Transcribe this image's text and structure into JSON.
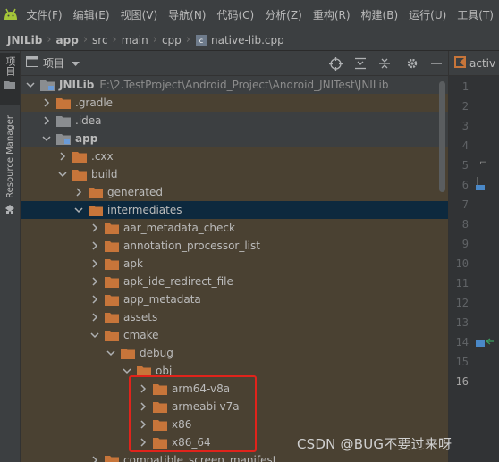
{
  "menu": {
    "items": [
      "文件(F)",
      "编辑(E)",
      "视图(V)",
      "导航(N)",
      "代码(C)",
      "分析(Z)",
      "重构(R)",
      "构建(B)",
      "运行(U)",
      "工具(T)"
    ]
  },
  "breadcrumb": {
    "items": [
      "JNILib",
      "app",
      "src",
      "main",
      "cpp",
      "native-lib.cpp"
    ]
  },
  "tool_strip": {
    "project_label": "项目",
    "resource_manager_label": "Resource Manager"
  },
  "project_pane": {
    "title": "项目"
  },
  "tree": [
    {
      "name": "JNILib",
      "path": "E:\\2.TestProject\\Android_Project\\Android_JNITest\\JNILib"
    },
    {
      "name": ".gradle"
    },
    {
      "name": ".idea"
    },
    {
      "name": "app"
    },
    {
      "name": ".cxx"
    },
    {
      "name": "build"
    },
    {
      "name": "generated"
    },
    {
      "name": "intermediates"
    },
    {
      "name": "aar_metadata_check"
    },
    {
      "name": "annotation_processor_list"
    },
    {
      "name": "apk"
    },
    {
      "name": "apk_ide_redirect_file"
    },
    {
      "name": "app_metadata"
    },
    {
      "name": "assets"
    },
    {
      "name": "cmake"
    },
    {
      "name": "debug"
    },
    {
      "name": "obj"
    },
    {
      "name": "arm64-v8a"
    },
    {
      "name": "armeabi-v7a"
    },
    {
      "name": "x86"
    },
    {
      "name": "x86_64"
    },
    {
      "name": "compatible_screen_manifest"
    }
  ],
  "editor": {
    "tab_label": "activ",
    "line_numbers": [
      "1",
      "2",
      "3",
      "4",
      "5",
      "6",
      "7",
      "8",
      "9",
      "10",
      "11",
      "12",
      "13",
      "14",
      "15",
      "16"
    ]
  },
  "watermark": "CSDN @BUG不要过来呀",
  "colors": {
    "background": "#2b2b2b",
    "panel": "#3c3f41",
    "selected_row": "#0d293e",
    "stripe_row": "#4a4132",
    "folder_orange": "#c7753a",
    "folder_gray": "#8a8d90",
    "highlight_red": "#e0231b",
    "android_green": "#a4c639"
  }
}
